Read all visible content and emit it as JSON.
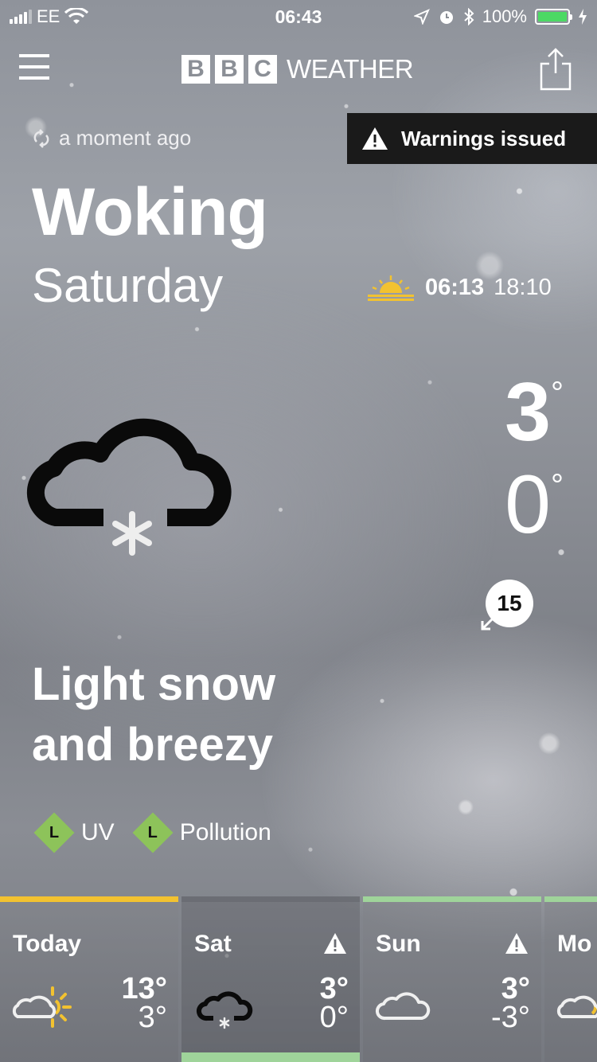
{
  "status_bar": {
    "carrier": "EE",
    "time": "06:43",
    "battery": "100%",
    "battery_level": 1.0
  },
  "header": {
    "logo_letters": [
      "B",
      "B",
      "C"
    ],
    "logo_word": "WEATHER",
    "menu_icon": "hamburger-menu-icon",
    "share_icon": "share-icon"
  },
  "updated": "a moment ago",
  "warnings_label": "Warnings issued",
  "location": "Woking",
  "day": "Saturday",
  "sunrise": "06:13",
  "sunset": "18:10",
  "weather_icon": "light-snow-cloud-icon",
  "temp_high": "3",
  "temp_low": "0",
  "degree_symbol": "°",
  "wind_speed": "15",
  "description_line1": "Light snow",
  "description_line2": "and breezy",
  "badges": [
    {
      "level": "L",
      "label": "UV"
    },
    {
      "level": "L",
      "label": "Pollution"
    }
  ],
  "colors": {
    "today_accent": "#f2c230",
    "sat_accent": "#9fd49a",
    "badge_green": "#8dc35a",
    "battery_green": "#4cd964"
  },
  "forecast": [
    {
      "day": "Today",
      "icon": "sun-cloud-icon",
      "high": "13°",
      "low": "3°",
      "warning": false
    },
    {
      "day": "Sat",
      "icon": "snow-cloud-icon",
      "high": "3°",
      "low": "0°",
      "warning": true
    },
    {
      "day": "Sun",
      "icon": "cloud-icon",
      "high": "3°",
      "low": "-3°",
      "warning": true
    },
    {
      "day": "Mo",
      "icon": "sun-cloud-icon",
      "high": "",
      "low": "",
      "warning": false
    }
  ]
}
